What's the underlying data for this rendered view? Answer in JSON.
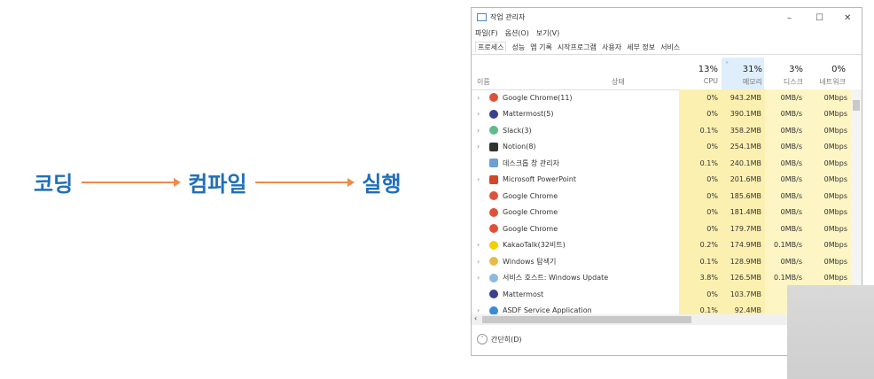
{
  "flow": {
    "steps": [
      "코딩",
      "컴파일",
      "실행"
    ],
    "text_color": "#1f6fb8",
    "arrow_color": "#ee8a4a"
  },
  "window": {
    "title": "작업 관리자",
    "controls": {
      "minimize": "–",
      "maximize": "☐",
      "close": "✕"
    },
    "menu": [
      "파일(F)",
      "옵션(O)",
      "보기(V)"
    ],
    "tabs": [
      "프로세스",
      "성능",
      "앱 기록",
      "시작프로그램",
      "사용자",
      "세부 정보",
      "서비스"
    ],
    "active_tab": "프로세스",
    "columns": {
      "name": "이름",
      "status": "상태",
      "cpu": {
        "pct": "13%",
        "label": "CPU"
      },
      "memory": {
        "pct": "31%",
        "label": "메모리",
        "sorted": true
      },
      "disk": {
        "pct": "3%",
        "label": "디스크"
      },
      "network": {
        "pct": "0%",
        "label": "네트워크"
      }
    },
    "processes": [
      {
        "name": "Google Chrome(11)",
        "icon": "chrome-icon",
        "expand": true,
        "cpu": "0%",
        "memory": "943.2MB",
        "disk": "0MB/s",
        "network": "0Mbps"
      },
      {
        "name": "Mattermost(5)",
        "icon": "mattermost-icon",
        "expand": true,
        "cpu": "0%",
        "memory": "390.1MB",
        "disk": "0MB/s",
        "network": "0Mbps"
      },
      {
        "name": "Slack(3)",
        "icon": "slack-icon",
        "expand": true,
        "cpu": "0.1%",
        "memory": "358.2MB",
        "disk": "0MB/s",
        "network": "0Mbps"
      },
      {
        "name": "Notion(8)",
        "icon": "notion-icon",
        "expand": true,
        "cpu": "0%",
        "memory": "254.1MB",
        "disk": "0MB/s",
        "network": "0Mbps"
      },
      {
        "name": "데스크톱 창 관리자",
        "icon": "desktop-window-icon",
        "expand": false,
        "cpu": "0.1%",
        "memory": "240.1MB",
        "disk": "0MB/s",
        "network": "0Mbps"
      },
      {
        "name": "Microsoft PowerPoint",
        "icon": "powerpoint-icon",
        "expand": true,
        "cpu": "0%",
        "memory": "201.6MB",
        "disk": "0MB/s",
        "network": "0Mbps"
      },
      {
        "name": "Google Chrome",
        "icon": "chrome-icon",
        "expand": false,
        "cpu": "0%",
        "memory": "185.6MB",
        "disk": "0MB/s",
        "network": "0Mbps"
      },
      {
        "name": "Google Chrome",
        "icon": "chrome-icon",
        "expand": false,
        "cpu": "0%",
        "memory": "181.4MB",
        "disk": "0MB/s",
        "network": "0Mbps"
      },
      {
        "name": "Google Chrome",
        "icon": "chrome-icon",
        "expand": false,
        "cpu": "0%",
        "memory": "179.7MB",
        "disk": "0MB/s",
        "network": "0Mbps"
      },
      {
        "name": "KakaoTalk(32비트)",
        "icon": "kakaotalk-icon",
        "expand": true,
        "cpu": "0.2%",
        "memory": "174.9MB",
        "disk": "0.1MB/s",
        "network": "0Mbps"
      },
      {
        "name": "Windows 탐색기",
        "icon": "explorer-icon",
        "expand": true,
        "cpu": "0.1%",
        "memory": "128.9MB",
        "disk": "0MB/s",
        "network": "0Mbps"
      },
      {
        "name": "서비스 호스트: Windows Update",
        "icon": "service-host-icon",
        "expand": true,
        "cpu": "3.8%",
        "memory": "126.5MB",
        "disk": "0.1MB/s",
        "network": "0Mbps"
      },
      {
        "name": "Mattermost",
        "icon": "mattermost-icon",
        "expand": false,
        "cpu": "0%",
        "memory": "103.7MB",
        "disk": "0",
        "network": ""
      },
      {
        "name": "ASDF Service Application",
        "icon": "app-icon",
        "expand": true,
        "cpu": "0.1%",
        "memory": "92.4MB",
        "disk": "0",
        "network": ""
      }
    ],
    "footer": "간단히(D)"
  }
}
